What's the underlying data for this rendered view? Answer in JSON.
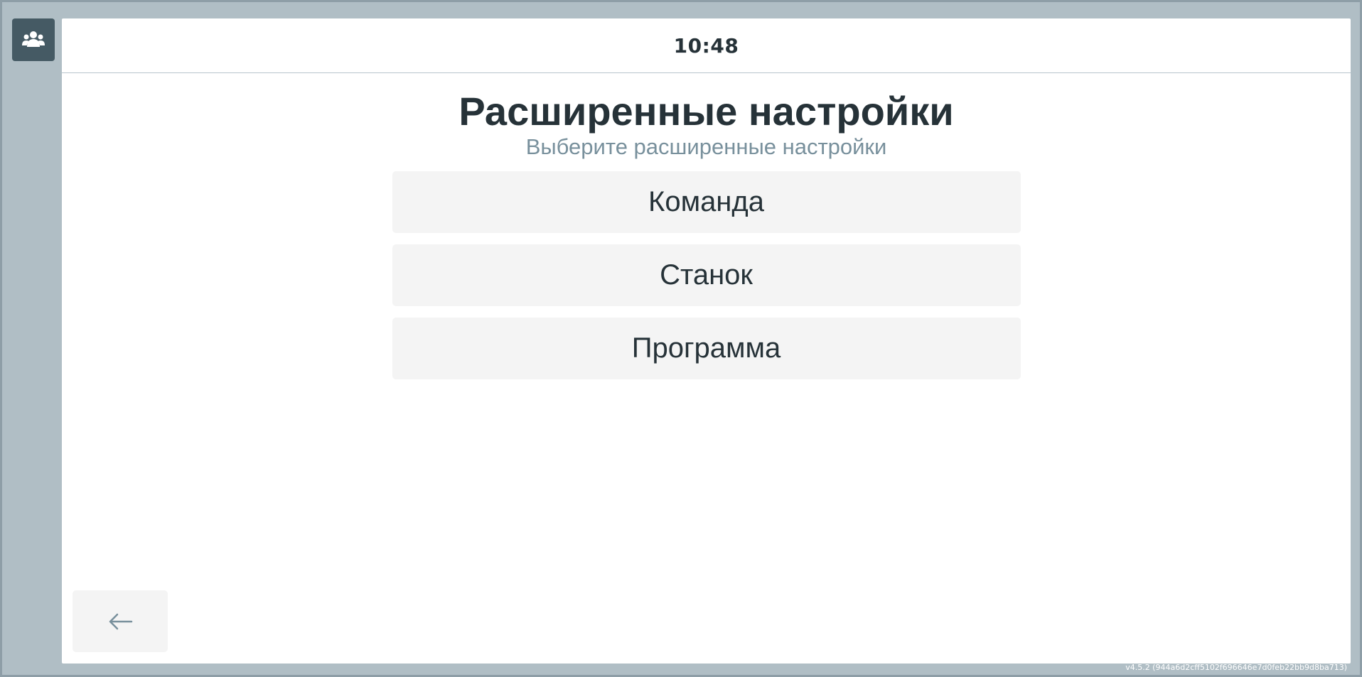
{
  "sidebar": {
    "team_icon": "users-icon"
  },
  "header": {
    "clock": "10:48"
  },
  "main": {
    "title": "Расширенные настройки",
    "subtitle": "Выберите расширенные настройки",
    "menu_items": [
      {
        "label": "Команда"
      },
      {
        "label": "Станок"
      },
      {
        "label": "Программа"
      }
    ]
  },
  "footer": {
    "back_icon": "arrow-left-icon",
    "version": "v4.5.2 (944a6d2cff5102f696646e7d0feb22bb9d8ba713)"
  },
  "colors": {
    "background": "#b0bec5",
    "side_button": "#455a64",
    "title": "#263238",
    "subtitle": "#78909c",
    "button_bg": "#f4f4f4"
  }
}
